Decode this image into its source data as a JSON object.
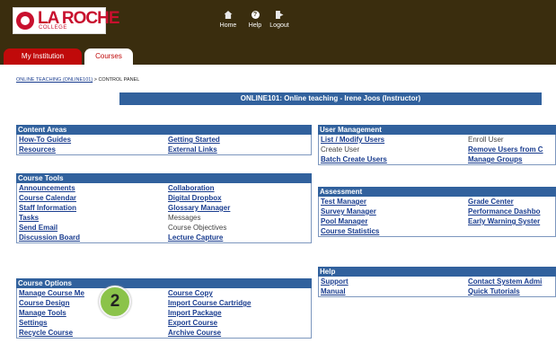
{
  "header": {
    "logo": {
      "brand": "LA ROCHE",
      "sub": "COLLEGE"
    },
    "tools": {
      "home": "Home",
      "help": "Help",
      "logout": "Logout"
    },
    "tabs": [
      {
        "label": "My Institution"
      },
      {
        "label": "Courses"
      }
    ]
  },
  "breadcrumb": {
    "course": "ONLINE TEACHING (ONLINE101)",
    "separator": ">",
    "current": "CONTROL PANEL"
  },
  "title": "ONLINE101: Online teaching - Irene Joos (Instructor)",
  "panels": {
    "content_areas": {
      "title": "Content Areas",
      "rows": [
        [
          "How-To Guides",
          "Getting Started"
        ],
        [
          "Resources",
          "External Links"
        ]
      ]
    },
    "course_tools": {
      "title": "Course Tools",
      "rows": [
        [
          "Announcements",
          "Collaboration"
        ],
        [
          "Course Calendar",
          "Digital Dropbox"
        ],
        [
          "Staff Information",
          "Glossary Manager"
        ],
        [
          "Tasks",
          "Messages"
        ],
        [
          "Send Email",
          "Course Objectives"
        ],
        [
          "Discussion Board",
          "Lecture Capture"
        ]
      ]
    },
    "course_options": {
      "title": "Course Options",
      "rows": [
        [
          "Manage Course Me",
          "Course Copy"
        ],
        [
          "Course Design",
          "Import Course Cartridge"
        ],
        [
          "Manage Tools",
          "Import Package"
        ],
        [
          "Settings",
          "Export Course"
        ],
        [
          "Recycle Course",
          "Archive Course"
        ]
      ]
    },
    "user_management": {
      "title": "User Management",
      "rows": [
        [
          "List / Modify Users",
          "Enroll User"
        ],
        [
          "Create User",
          "Remove Users from C"
        ],
        [
          "Batch Create Users",
          "Manage Groups"
        ]
      ]
    },
    "assessment": {
      "title": "Assessment",
      "rows": [
        [
          "Test Manager",
          "Grade Center"
        ],
        [
          "Survey Manager",
          "Performance Dashbo"
        ],
        [
          "Pool Manager",
          "Early Warning Syster"
        ],
        [
          "Course Statistics",
          ""
        ]
      ]
    },
    "help": {
      "title": "Help",
      "rows": [
        [
          "Support",
          "Contact System Admi"
        ],
        [
          "Manual",
          "Quick Tutorials"
        ]
      ]
    }
  },
  "step_badge": "2",
  "colors": {
    "header_bg": "#3a2d0e",
    "tab_active": "#c00a0a",
    "panel_header": "#31619d",
    "link": "#1a3d8f",
    "badge": "#8bc34a"
  }
}
